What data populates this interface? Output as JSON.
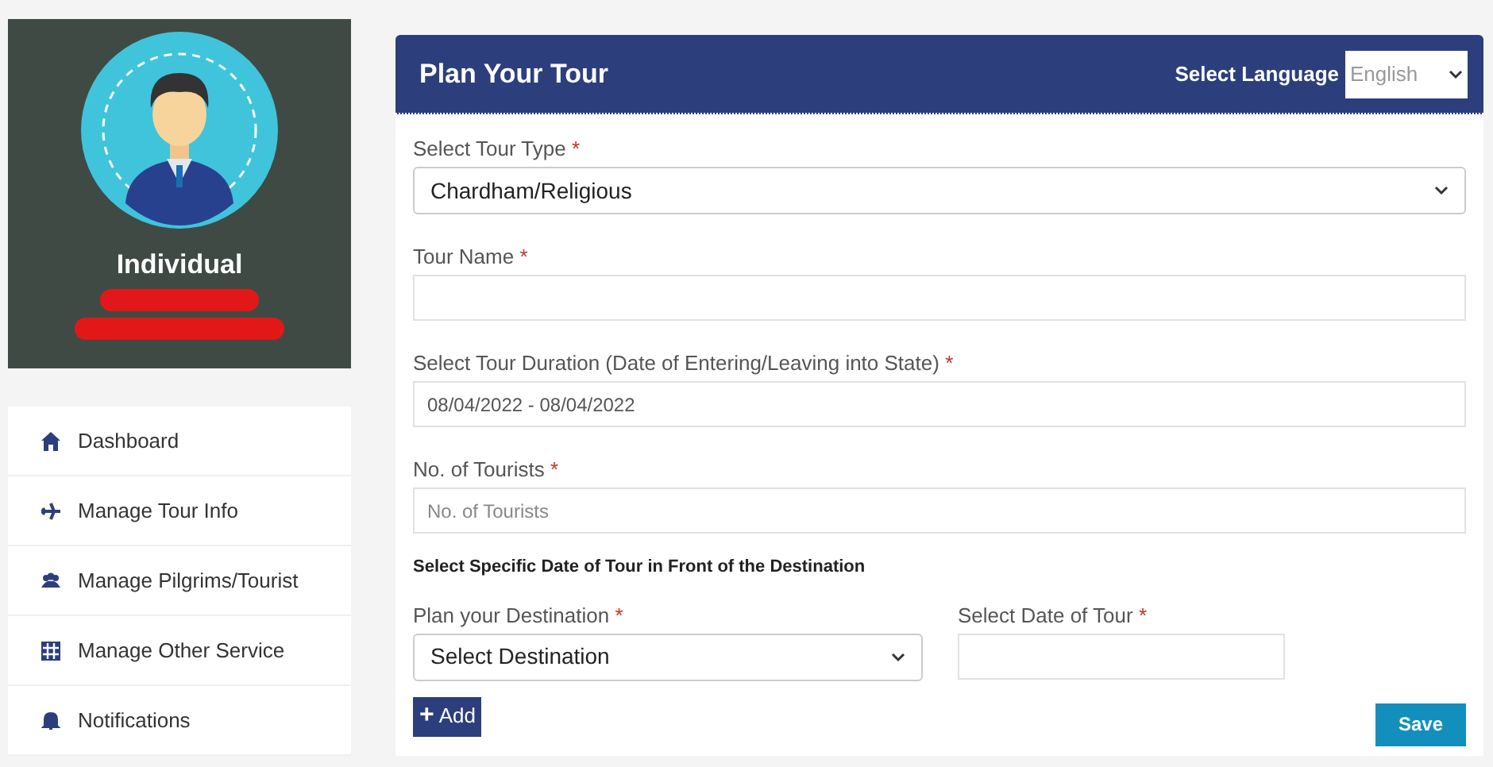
{
  "profile": {
    "role": "Individual"
  },
  "sidebar": {
    "items": [
      {
        "label": "Dashboard",
        "kind": "home"
      },
      {
        "label": "Manage Tour Info",
        "kind": "plane"
      },
      {
        "label": "Manage Pilgrims/Tourist",
        "kind": "users"
      },
      {
        "label": "Manage Other Service",
        "kind": "grid"
      },
      {
        "label": "Notifications",
        "kind": "bell"
      }
    ]
  },
  "header": {
    "title": "Plan Your Tour",
    "language_label": "Select Language",
    "language": "English"
  },
  "fields": [
    {
      "kind": "select",
      "label": "Select Tour Type",
      "required_mark": "*",
      "value": "Chardham/Religious"
    },
    {
      "kind": "input",
      "label": "Tour Name",
      "required_mark": "*"
    },
    {
      "kind": "input",
      "label": "Select Tour Duration (Date of Entering/Leaving into State)",
      "required_mark": "*",
      "value": "08/04/2022 - 08/04/2022"
    },
    {
      "kind": "input",
      "label": "No. of Tourists",
      "required_mark": "*",
      "placeholder": "No. of Tourists"
    }
  ],
  "section_heading": "Select Specific Date of Tour in Front of the Destination",
  "destination_fields": [
    {
      "kind": "select",
      "label": "Plan your Destination",
      "required_mark": "*",
      "value": "Select Destination"
    },
    {
      "kind": "input",
      "label": "Select Date of Tour",
      "required_mark": "*"
    }
  ],
  "add_button": {
    "icon": "+",
    "label": "Add"
  },
  "save_button": "Save"
}
